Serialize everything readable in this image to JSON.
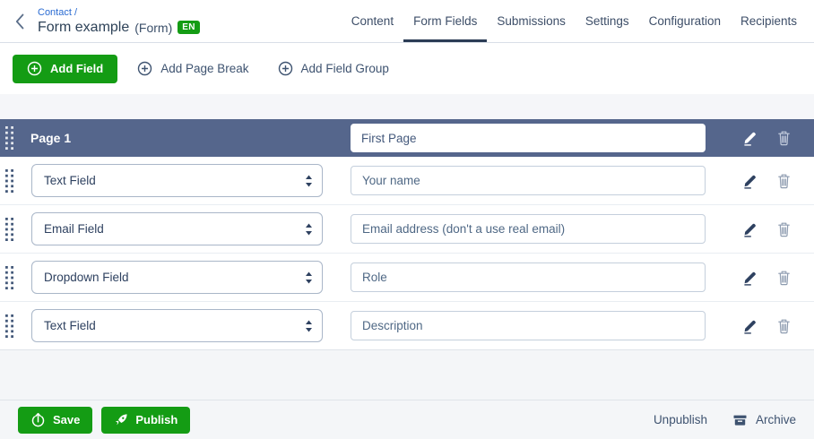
{
  "header": {
    "breadcrumb": "Contact /",
    "title": "Form example",
    "title_suffix": "(Form)",
    "locale_badge": "EN",
    "tabs": [
      {
        "label": "Content",
        "active": false
      },
      {
        "label": "Form Fields",
        "active": true
      },
      {
        "label": "Submissions",
        "active": false
      },
      {
        "label": "Settings",
        "active": false
      },
      {
        "label": "Configuration",
        "active": false
      },
      {
        "label": "Recipients",
        "active": false
      }
    ]
  },
  "toolbar": {
    "add_field": "Add Field",
    "add_page_break": "Add Page Break",
    "add_field_group": "Add Field Group"
  },
  "page_section": {
    "title": "Page 1",
    "name_value": "First Page"
  },
  "fields": [
    {
      "type": "Text Field",
      "label": "Your name"
    },
    {
      "type": "Email Field",
      "label": "Email address (don't a use real email)"
    },
    {
      "type": "Dropdown Field",
      "label": "Role"
    },
    {
      "type": "Text Field",
      "label": "Description"
    }
  ],
  "footer": {
    "save": "Save",
    "publish": "Publish",
    "unpublish": "Unpublish",
    "archive": "Archive"
  },
  "colors": {
    "accent_green": "#149c14",
    "page_bar_blue": "#55668c",
    "link_blue": "#2a6bd2",
    "text_navy": "#2e4160"
  },
  "icons": {
    "back": "chevron-left",
    "add": "plus-circle",
    "edit": "pencil",
    "delete": "trash",
    "drag": "grip-dots",
    "save": "upload-circle-arrow",
    "publish": "rocket",
    "archive": "archive-box",
    "select_spinner": "up-down-arrows"
  }
}
